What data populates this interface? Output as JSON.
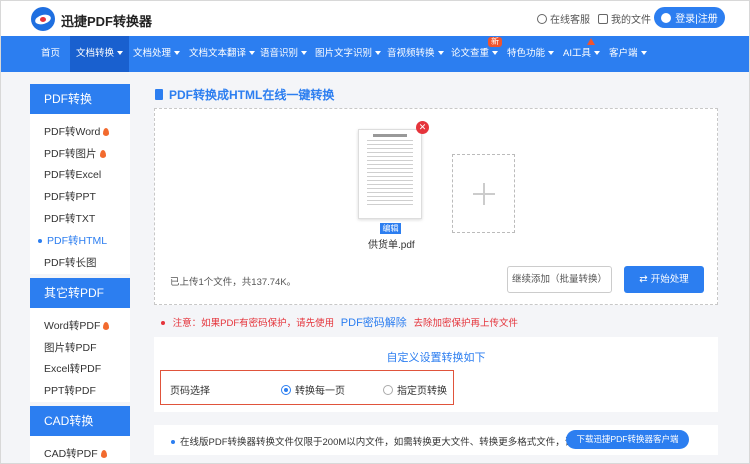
{
  "header": {
    "brand": "迅捷PDF转换器",
    "support": "在线客服",
    "my_files": "我的文件",
    "login": "登录|注册"
  },
  "nav": {
    "items": [
      "首页",
      "文档转换",
      "文档处理",
      "文档文本翻译",
      "语音识别",
      "图片文字识别",
      "音视频转换",
      "论文查重",
      "特色功能",
      "AI工具",
      "客户端"
    ],
    "badge_new": "新"
  },
  "sidebar": {
    "group1": {
      "title": "PDF转换",
      "items": [
        "PDF转Word",
        "PDF转图片",
        "PDF转Excel",
        "PDF转PPT",
        "PDF转TXT",
        "PDF转HTML",
        "PDF转长图"
      ]
    },
    "group2": {
      "title": "其它转PDF",
      "items": [
        "Word转PDF",
        "图片转PDF",
        "Excel转PDF",
        "PPT转PDF"
      ]
    },
    "group3": {
      "title": "CAD转换",
      "items": [
        "CAD转PDF"
      ]
    }
  },
  "main": {
    "title": "PDF转换成HTML在线一键转换",
    "file_name": "供货单.pdf",
    "edit_label": "编辑",
    "upload_info": "已上传1个文件，共137.74K。",
    "continue_btn": "继续添加（批量转换）",
    "start_btn": "开始处理",
    "notice_pre": "注意：如果PDF有密码保护，请先使用",
    "notice_link": "PDF密码解除",
    "notice_post": "去除加密保护再上传文件",
    "settings_title": "自定义设置转换如下",
    "page_label": "页码选择",
    "option_all": "转换每一页",
    "option_specific": "指定页转换",
    "footer_text": "在线版PDF转换器转换文件仅限于200M以内文件，如需转换更大文件、转换更多格式文件，请",
    "footer_btn": "下载迅捷PDF转换器客户端"
  },
  "colors": {
    "primary": "#2c7ef0",
    "nav_active": "#1960cf",
    "alert": "#e5343b"
  }
}
